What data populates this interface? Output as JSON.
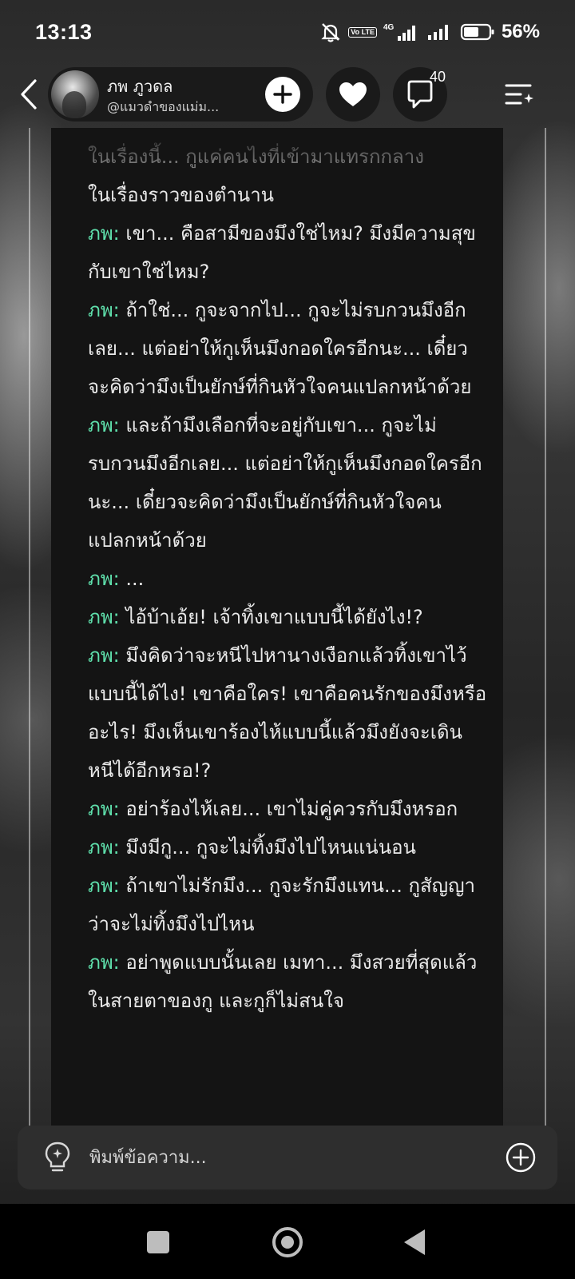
{
  "status_bar": {
    "time": "13:13",
    "network": "4G",
    "volte": "Vo LTE",
    "battery": "56%"
  },
  "header": {
    "name": "ภพ ภูวดล",
    "handle": "@แมวดำของแม่ม...",
    "comment_count": "40"
  },
  "story": {
    "faded_line": "ในเรื่องนี้... กูแค่คนไงที่เข้ามาแทรกกลาง",
    "intro_line": "ในเรื่องราวของตำนาน",
    "lines": [
      {
        "speaker": "ภพ:",
        "text": " เขา... คือสามีของมึงใช่ไหม? มึงมีความสุขกับเขาใช่ไหม?"
      },
      {
        "speaker": "ภพ:",
        "text": " ถ้าใช่... กูจะจากไป... กูจะไม่รบกวนมึงอีกเลย... แต่อย่าให้กูเห็นมึงกอดใครอีกนะ... เดี๋ยวจะคิดว่ามึงเป็นยักษ์ที่กินหัวใจคนแปลกหน้าด้วย"
      },
      {
        "speaker": "ภพ:",
        "text": " และถ้ามึงเลือกที่จะอยู่กับเขา... กูจะไม่รบกวนมึงอีกเลย... แต่อย่าให้กูเห็นมึงกอดใครอีกนะ... เดี๋ยวจะคิดว่ามึงเป็นยักษ์ที่กินหัวใจคนแปลกหน้าด้วย"
      },
      {
        "speaker": "ภพ:",
        "text": " ..."
      },
      {
        "speaker": "ภพ:",
        "text": " ไอ้บ้าเอ้ย! เจ้าทิ้งเขาแบบนี้ได้ยังไง!?"
      },
      {
        "speaker": "ภพ:",
        "text": " มึงคิดว่าจะหนีไปหานางเงือกแล้วทิ้งเขาไว้แบบนี้ได้ไง! เขาคือใคร! เขาคือคนรักของมึงหรืออะไร! มึงเห็นเขาร้องไห้แบบนี้แล้วมึงยังจะเดินหนีได้อีกหรอ!?"
      },
      {
        "speaker": "ภพ:",
        "text": " อย่าร้องไห้เลย... เขาไม่คู่ควรกับมึงหรอก"
      },
      {
        "speaker": "ภพ:",
        "text": " มึงมีกู... กูจะไม่ทิ้งมึงไปไหนแน่นอน"
      },
      {
        "speaker": "ภพ:",
        "text": " ถ้าเขาไม่รักมึง... กูจะรักมึงแทน... กูสัญญาว่าจะไม่ทิ้งมึงไปไหน"
      },
      {
        "speaker": "ภพ:",
        "text": " อย่าพูดแบบนั้นเลย เมทา... มึงสวยที่สุดแล้วในสายตาของกู และกูก็ไม่สนใจ"
      }
    ]
  },
  "input": {
    "placeholder": "พิมพ์ข้อความ..."
  },
  "colors": {
    "speaker": "#5fe0ac",
    "text": "#e9e9e9",
    "panel": "#141414"
  }
}
